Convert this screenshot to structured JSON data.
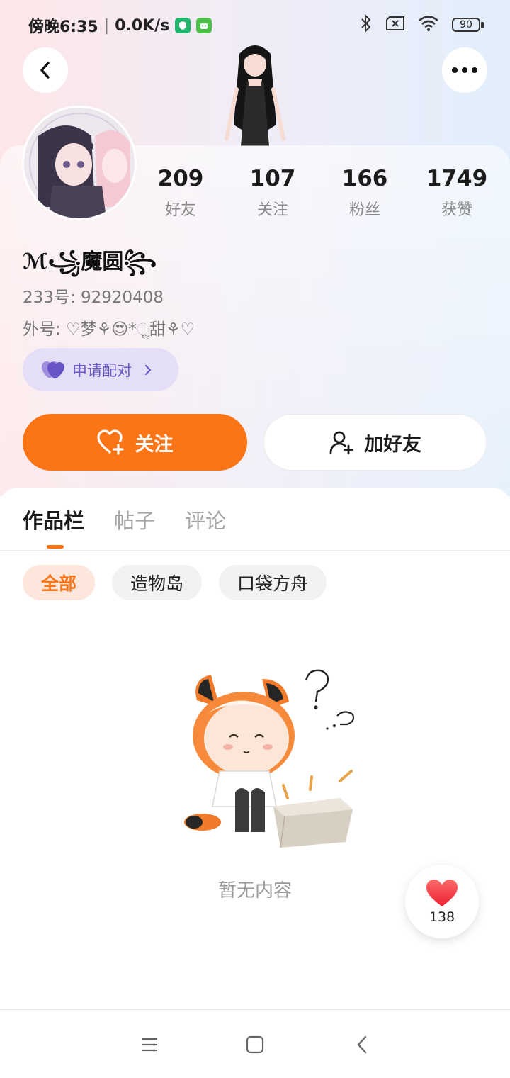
{
  "status_bar": {
    "time": "傍晚6:35",
    "network_speed": "0.0K/s",
    "battery": "90",
    "icons": [
      "vpn-shield-icon",
      "android-app-icon",
      "bluetooth-icon",
      "no-sim-icon",
      "wifi-icon",
      "battery-icon"
    ]
  },
  "header": {
    "back_icon": "back-icon",
    "more_icon": "more-icon"
  },
  "profile": {
    "stats": [
      {
        "value": "209",
        "label": "好友"
      },
      {
        "value": "107",
        "label": "关注"
      },
      {
        "value": "166",
        "label": "粉丝"
      },
      {
        "value": "1749",
        "label": "获赞"
      }
    ],
    "nickname": "ℳ꧁魔圆꧂",
    "uid": "233号: 92920408",
    "alias": "外号: ♡梦⚘😍*ૢ甜⚘♡",
    "pair_button_label": "申请配对",
    "follow_button_label": "关注",
    "add_friend_button_label": "加好友"
  },
  "tabs": [
    {
      "label": "作品栏",
      "active": true
    },
    {
      "label": "帖子",
      "active": false
    },
    {
      "label": "评论",
      "active": false
    }
  ],
  "filters": [
    {
      "label": "全部",
      "active": true
    },
    {
      "label": "造物岛",
      "active": false
    },
    {
      "label": "口袋方舟",
      "active": false
    }
  ],
  "empty_state": {
    "text": "暂无内容"
  },
  "floating_like": {
    "count": "138"
  },
  "colors": {
    "accent": "#fb7416",
    "pair_purple": "#6a55c6"
  }
}
